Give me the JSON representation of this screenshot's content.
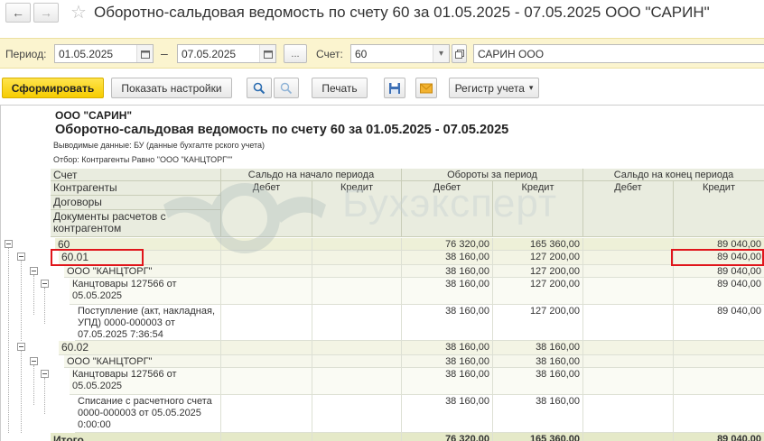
{
  "window": {
    "title": "Оборотно-сальдовая ведомость по счету 60 за 01.05.2025 - 07.05.2025 ООО \"САРИН\"",
    "back_icon": "←",
    "forward_icon": "→",
    "star_icon": "☆"
  },
  "params": {
    "period_label": "Период:",
    "date_from": "01.05.2025",
    "dash": "–",
    "date_to": "07.05.2025",
    "dots": "...",
    "account_label": "Счет:",
    "account_value": "60",
    "organization": "САРИН ООО"
  },
  "toolbar": {
    "generate": "Сформировать",
    "show_settings": "Показать настройки",
    "print": "Печать",
    "ledger": "Регистр учета"
  },
  "report": {
    "org": "ООО \"САРИН\"",
    "title": "Оборотно-сальдовая ведомость по счету 60 за 01.05.2025 - 07.05.2025",
    "output_data": "Выводимые данные: БУ (данные бухгалте рского учета)",
    "filter": "Отбор: Контрагенты Равно \"ООО \"КАНЦТОРГ\"\"",
    "watermark": "Бухэксперт"
  },
  "table": {
    "left_headers": [
      "Счет",
      "Контрагенты",
      "Договоры",
      "Документы расчетов с контрагентом"
    ],
    "groups": [
      "Сальдо на начало периода",
      "Обороты за период",
      "Сальдо на конец периода"
    ],
    "sub": [
      "Дебет",
      "Кредит",
      "Дебет",
      "Кредит",
      "Дебет",
      "Кредит"
    ],
    "rows": [
      {
        "level": 0,
        "name": "60",
        "v": [
          "",
          "",
          "76 320,00",
          "165 360,00",
          "",
          "89 040,00"
        ]
      },
      {
        "level": 1,
        "name": "60.01",
        "v": [
          "",
          "",
          "38 160,00",
          "127 200,00",
          "",
          "89 040,00"
        ]
      },
      {
        "level": 2,
        "name": "ООО \"КАНЦТОРГ\"",
        "v": [
          "",
          "",
          "38 160,00",
          "127 200,00",
          "",
          "89 040,00"
        ]
      },
      {
        "level": 3,
        "name": "Канцтовары 127566 от 05.05.2025",
        "v": [
          "",
          "",
          "38 160,00",
          "127 200,00",
          "",
          "89 040,00"
        ]
      },
      {
        "level": 4,
        "name": "Поступление (акт, накладная, УПД) 0000-000003 от 07.05.2025 7:36:54",
        "v": [
          "",
          "",
          "38 160,00",
          "127 200,00",
          "",
          "89 040,00"
        ]
      },
      {
        "level": 1,
        "name": "60.02",
        "v": [
          "",
          "",
          "38 160,00",
          "38 160,00",
          "",
          ""
        ]
      },
      {
        "level": 2,
        "name": "ООО \"КАНЦТОРГ\"",
        "v": [
          "",
          "",
          "38 160,00",
          "38 160,00",
          "",
          ""
        ]
      },
      {
        "level": 3,
        "name": "Канцтовары 127566 от 05.05.2025",
        "v": [
          "",
          "",
          "38 160,00",
          "38 160,00",
          "",
          ""
        ]
      },
      {
        "level": 4,
        "name": "Списание с расчетного счета 0000-000003 от 05.05.2025 0:00:00",
        "v": [
          "",
          "",
          "38 160,00",
          "38 160,00",
          "",
          ""
        ]
      }
    ],
    "total": {
      "name": "Итого",
      "v": [
        "",
        "",
        "76 320,00",
        "165 360,00",
        "",
        "89 040,00"
      ]
    }
  },
  "colors": {
    "accent": "#f6cc00",
    "highlight_box": "#e0151b",
    "row_level0": "#eef0d8",
    "row_level1": "#f3f4e4",
    "row_level2": "#f6f7ec",
    "total_row": "#e5e9c8"
  }
}
